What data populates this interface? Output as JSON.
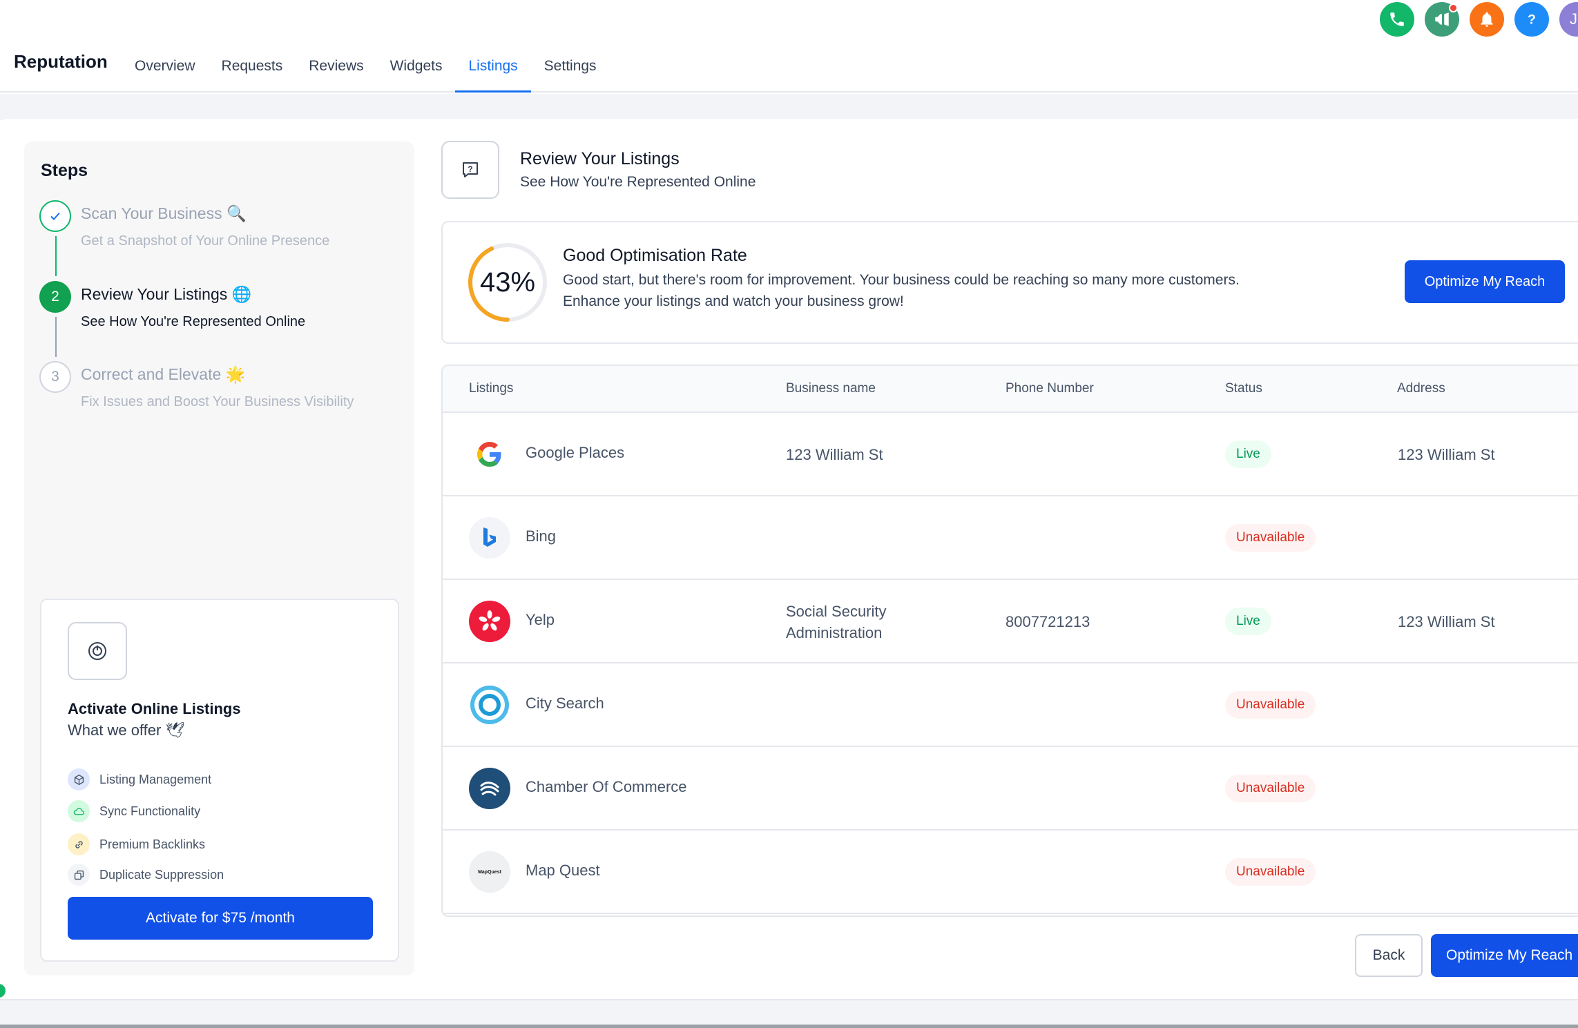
{
  "app": {
    "title": "Reputation"
  },
  "nav": {
    "items": [
      "Overview",
      "Requests",
      "Reviews",
      "Widgets",
      "Listings",
      "Settings"
    ],
    "active": "Listings"
  },
  "top_icons": [
    {
      "name": "phone-icon",
      "color": "#12b76a"
    },
    {
      "name": "megaphone-icon",
      "color": "#3d9f7a"
    },
    {
      "name": "bell-icon",
      "color": "#f97316"
    },
    {
      "name": "help-icon",
      "color": "#1d8cf8"
    }
  ],
  "avatar": {
    "initial": "J"
  },
  "steps": {
    "title": "Steps",
    "items": [
      {
        "title": "Scan Your Business",
        "emoji": "🔍",
        "subtitle": "Get a Snapshot of Your Online Presence",
        "state": "done"
      },
      {
        "number": "2",
        "title": "Review Your Listings",
        "emoji": "🌐",
        "subtitle": "See How You're Represented Online",
        "state": "active"
      },
      {
        "number": "3",
        "title": "Correct and Elevate",
        "emoji": "🌟",
        "subtitle": "Fix Issues and Boost Your Business Visibility",
        "state": "pending"
      }
    ]
  },
  "offer": {
    "title": "Activate Online Listings",
    "subtitle": "What we offer 🕊",
    "features": [
      {
        "label": "Listing Management",
        "icon": "cube-icon",
        "color": "#c7d7fe"
      },
      {
        "label": "Sync Functionality",
        "icon": "cloud-icon",
        "color": "#d1fadf"
      },
      {
        "label": "Premium Backlinks",
        "icon": "link-icon",
        "color": "#fef0c7"
      },
      {
        "label": "Duplicate Suppression",
        "icon": "copy-icon",
        "color": "#f2f4f7"
      }
    ],
    "button": "Activate for $75 /month"
  },
  "review": {
    "title": "Review Your Listings",
    "subtitle": "See How You're Represented Online"
  },
  "optimisation": {
    "percent": 43,
    "percent_label": "43%",
    "title": "Good Optimisation Rate",
    "description": "Good start, but there's room for improvement. Your business could be reaching so many more customers. Enhance your listings and watch your business grow!",
    "button": "Optimize My Reach"
  },
  "table": {
    "headers": [
      "Listings",
      "Business name",
      "Phone Number",
      "Status",
      "Address"
    ],
    "rows": [
      {
        "listing": "Google Places",
        "logo": "google-icon",
        "business": "123 William St",
        "phone": "",
        "status": "Live",
        "address": "123 William St"
      },
      {
        "listing": "Bing",
        "logo": "bing-icon",
        "business": "",
        "phone": "",
        "status": "Unavailable",
        "address": ""
      },
      {
        "listing": "Yelp",
        "logo": "yelp-icon",
        "business": "Social Security Administration",
        "phone": "8007721213",
        "status": "Live",
        "address": "123 William St"
      },
      {
        "listing": "City Search",
        "logo": "citysearch-icon",
        "business": "",
        "phone": "",
        "status": "Unavailable",
        "address": ""
      },
      {
        "listing": "Chamber Of Commerce",
        "logo": "chamber-icon",
        "business": "",
        "phone": "",
        "status": "Unavailable",
        "address": ""
      },
      {
        "listing": "Map Quest",
        "logo": "mapquest-icon",
        "logo_text": "MapQuest",
        "business": "",
        "phone": "",
        "status": "Unavailable",
        "address": ""
      }
    ]
  },
  "footer": {
    "back": "Back",
    "optimize": "Optimize My Reach"
  }
}
